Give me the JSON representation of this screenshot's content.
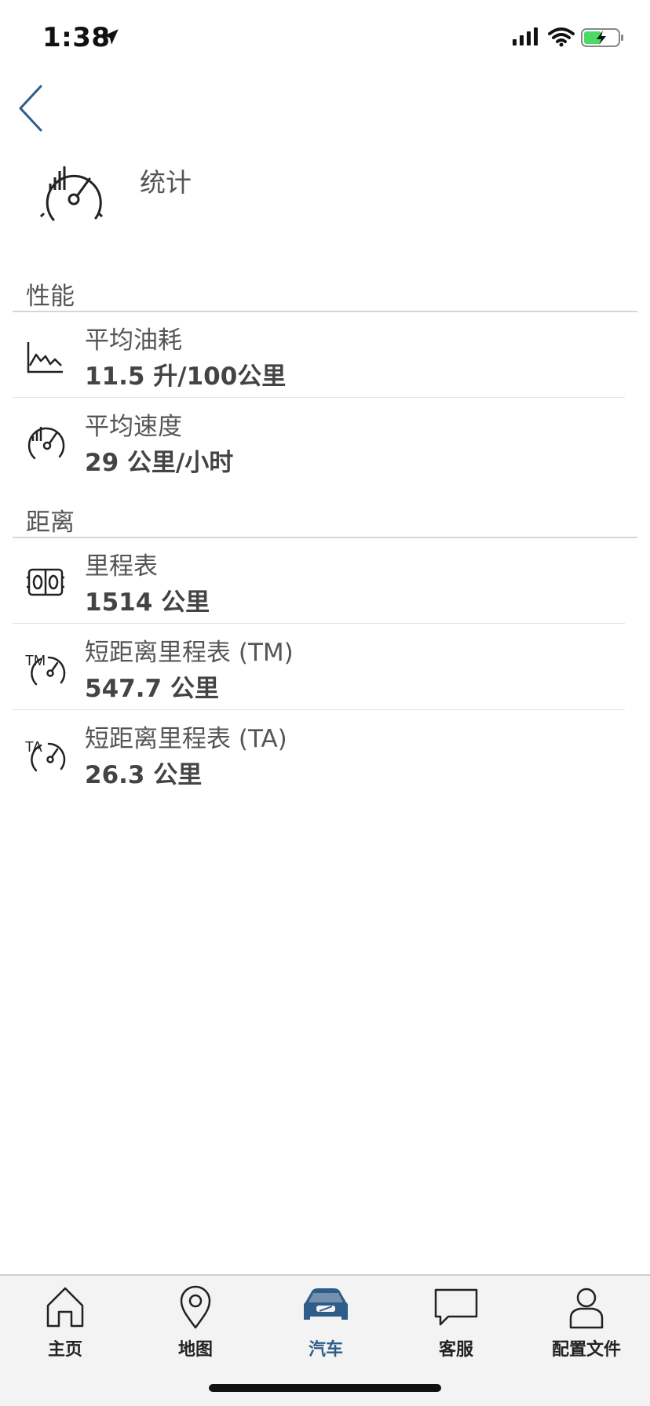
{
  "status_bar": {
    "time": "1:38"
  },
  "header": {
    "title": "统计"
  },
  "sections": [
    {
      "title": "性能",
      "rows": [
        {
          "icon": "fuel-consumption-chart-icon",
          "label": "平均油耗",
          "value": "11.5 升/100公里"
        },
        {
          "icon": "speedometer-icon",
          "label": "平均速度",
          "value": "29 公里/小时"
        }
      ]
    },
    {
      "title": "距离",
      "rows": [
        {
          "icon": "odometer-icon",
          "label": "里程表",
          "value": "1514 公里"
        },
        {
          "icon": "trip-meter-tm-icon",
          "label": "短距离里程表 (TM)",
          "value": "547.7 公里",
          "badge": "TM"
        },
        {
          "icon": "trip-meter-ta-icon",
          "label": "短距离里程表 (TA)",
          "value": "26.3 公里",
          "badge": "TA"
        }
      ]
    }
  ],
  "tab_bar": {
    "tabs": [
      {
        "label": "主页",
        "icon": "home-icon"
      },
      {
        "label": "地图",
        "icon": "map-pin-icon"
      },
      {
        "label": "汽车",
        "icon": "car-icon",
        "active": true
      },
      {
        "label": "客服",
        "icon": "chat-bubble-icon"
      },
      {
        "label": "配置文件",
        "icon": "profile-icon"
      }
    ]
  },
  "colors": {
    "accent": "#2e5d8a",
    "text": "#555555",
    "divider": "#d6d6d6",
    "battery": "#4cd964"
  }
}
